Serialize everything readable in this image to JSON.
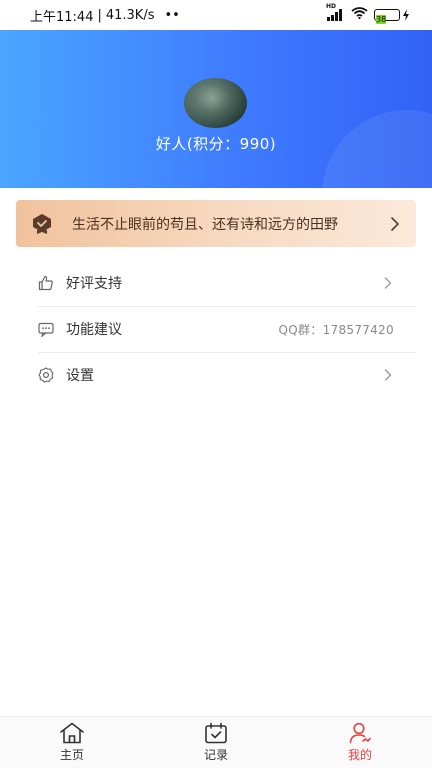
{
  "status_bar": {
    "time": "上午11:44",
    "separator": "|",
    "net_speed": "41.3K/s",
    "dots": "••",
    "hd_label": "HD",
    "battery": "38",
    "battery_color": "#7ed321"
  },
  "header": {
    "user_name": "好人(积分：990)",
    "gradient_colors": [
      "#4aa6ff",
      "#3162f5"
    ]
  },
  "banner": {
    "text": "生活不止眼前的苟且、还有诗和远方的田野",
    "icon": "medal-icon",
    "arrow_icon": "chevron-right-icon"
  },
  "menu": {
    "items": [
      {
        "label": "好评支持",
        "icon": "thumbs-up-icon",
        "value": "",
        "arrow": true
      },
      {
        "label": "功能建议",
        "icon": "message-dots-icon",
        "value": "QQ群：178577420",
        "arrow": false
      },
      {
        "label": "设置",
        "icon": "gear-icon",
        "value": "",
        "arrow": true
      }
    ]
  },
  "tabbar": {
    "active_color": "#e44141",
    "tabs": [
      {
        "label": "主页",
        "icon": "home-icon",
        "active": false
      },
      {
        "label": "记录",
        "icon": "calendar-check-icon",
        "active": false
      },
      {
        "label": "我的",
        "icon": "user-icon",
        "active": true
      }
    ]
  }
}
